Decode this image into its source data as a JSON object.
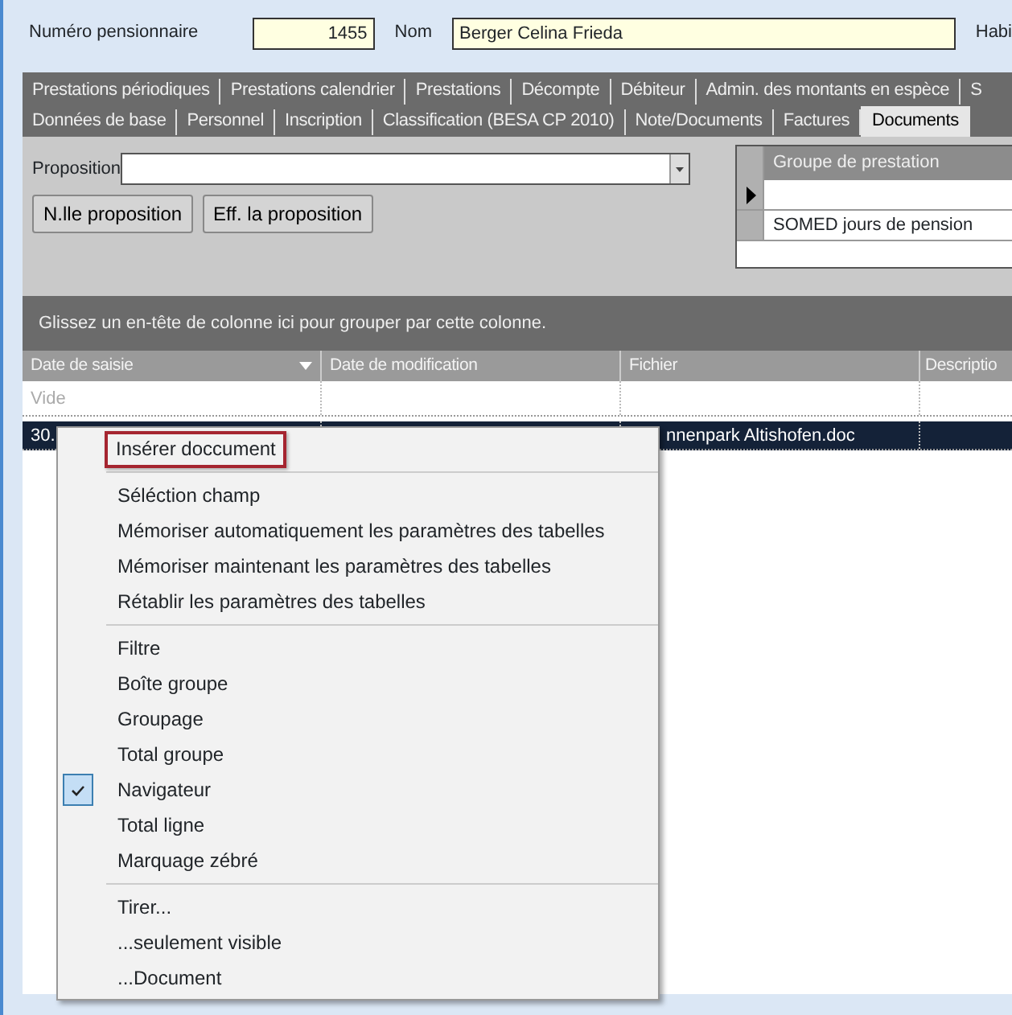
{
  "header": {
    "fields": [
      {
        "label": "Numéro pensionnaire",
        "value": "1455"
      },
      {
        "label": "Nom",
        "value": "Berger Celina Frieda"
      }
    ],
    "cut_label": "Habi"
  },
  "tabs": {
    "back_row": [
      {
        "label": "Prestations périodiques",
        "selected": false
      },
      {
        "label": "Prestations calendrier",
        "selected": false
      },
      {
        "label": "Prestations",
        "selected": false
      },
      {
        "label": "Décompte",
        "selected": false
      },
      {
        "label": "Débiteur",
        "selected": false
      },
      {
        "label": "Admin. des montants en espèce",
        "selected": false
      },
      {
        "label": "S",
        "selected": false
      }
    ],
    "front_row": [
      {
        "label": "Données de base",
        "selected": false
      },
      {
        "label": "Personnel",
        "selected": false
      },
      {
        "label": "Inscription",
        "selected": false
      },
      {
        "label": "Classification (BESA CP 2010)",
        "selected": false
      },
      {
        "label": "Note/Documents",
        "selected": false
      },
      {
        "label": "Factures",
        "selected": false
      },
      {
        "label": "Documents",
        "selected": true
      }
    ]
  },
  "proposition": {
    "label": "Proposition",
    "buttons": [
      "N.lle proposition",
      "Eff. la proposition"
    ]
  },
  "service_group_grid": {
    "column": "Groupe de prestation",
    "rows": [
      {
        "text": "",
        "current": true
      },
      {
        "text": "SOMED jours de pension",
        "current": false
      }
    ]
  },
  "group_panel": "Glissez un en-tête de colonne ici pour grouper par cette colonne.",
  "documents_grid": {
    "columns": [
      {
        "label": "Date de saisie",
        "sorted": true
      },
      {
        "label": "Date de modification",
        "sorted": false
      },
      {
        "label": "Fichier",
        "sorted": false
      },
      {
        "label": "Descriptio",
        "sorted": false
      }
    ],
    "placeholder": "Vide",
    "rows": [
      {
        "selected": true,
        "cells": [
          "30.",
          "",
          "nnenpark Altishofen.doc",
          ""
        ]
      }
    ]
  },
  "context_menu": {
    "sections": [
      [
        {
          "label": "Insérer doccument",
          "checked": false,
          "highlighted": true
        }
      ],
      [
        {
          "label": "Séléction champ",
          "checked": false,
          "highlighted": false
        },
        {
          "label": "Mémoriser automatiquement les paramètres des tabelles",
          "checked": false,
          "highlighted": false
        },
        {
          "label": "Mémoriser maintenant les paramètres des tabelles",
          "checked": false,
          "highlighted": false
        },
        {
          "label": "Rétablir les paramètres des tabelles",
          "checked": false,
          "highlighted": false
        }
      ],
      [
        {
          "label": "Filtre",
          "checked": false,
          "highlighted": false
        },
        {
          "label": "Boîte groupe",
          "checked": false,
          "highlighted": false
        },
        {
          "label": "Groupage",
          "checked": false,
          "highlighted": false
        },
        {
          "label": "Total groupe",
          "checked": false,
          "highlighted": false
        },
        {
          "label": "Navigateur",
          "checked": true,
          "highlighted": false
        },
        {
          "label": "Total ligne",
          "checked": false,
          "highlighted": false
        },
        {
          "label": "Marquage zébré",
          "checked": false,
          "highlighted": false
        }
      ],
      [
        {
          "label": "Tirer...",
          "checked": false,
          "highlighted": false
        },
        {
          "label": "...seulement visible",
          "checked": false,
          "highlighted": false
        },
        {
          "label": "...Document",
          "checked": false,
          "highlighted": false
        }
      ]
    ]
  }
}
